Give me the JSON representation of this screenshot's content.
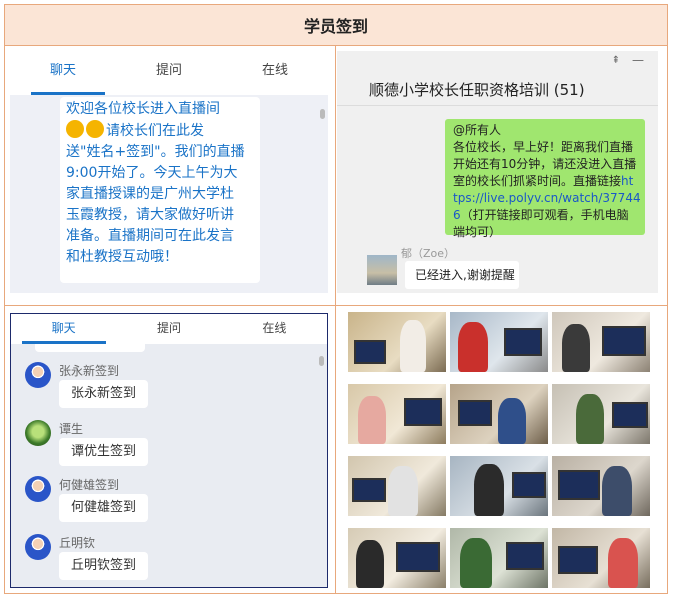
{
  "page": {
    "title": "学员签到"
  },
  "chat_panel_a": {
    "tabs": [
      {
        "label": "聊天",
        "active": true
      },
      {
        "label": "提问",
        "active": false
      },
      {
        "label": "在线",
        "active": false
      }
    ],
    "message_lines": [
      "欢迎各位校长进入直播间",
      "请校长们在此发",
      "送\"姓名+签到\"。我们的直播",
      "9:00开始了。今天上午为大",
      "家直播授课的是广州大学杜",
      "玉霞教授，请大家做好听讲",
      "准备。直播期间可在此发言",
      "和杜教授互动哦！"
    ],
    "accent_color": "#1a73c7"
  },
  "wechat_panel": {
    "group_title": "顺德小学校长任职资格培训 (51)",
    "pin_icon": "pin-icon",
    "minimize_icon": "minimize-icon",
    "message": {
      "lines_plain": [
        "@所有人",
        "各位校长，早上好！距离我们直播",
        "开始还有10分钟，请还没进入直播",
        "室的校长们抓紧时间。直播链接"
      ],
      "link_part1": "ht",
      "link_part2": "tps://live.polyv.cn/watch/37744",
      "link_part3": "6",
      "tail": "（打开链接即可观看，手机电脑",
      "tail2": "端均可）",
      "bubble_color": "#a0e66f"
    },
    "reply": {
      "sender": "郁（Zoe）",
      "text": "已经进入,谢谢提醒"
    }
  },
  "chat_panel_c": {
    "tabs": [
      {
        "label": "聊天",
        "active": true
      },
      {
        "label": "提问",
        "active": false
      },
      {
        "label": "在线",
        "active": false
      }
    ],
    "entries": [
      {
        "name": "张永新签到",
        "message": "张永新签到",
        "avatar": "user-avatar-blue"
      },
      {
        "name": "谭生",
        "message": "谭优生签到",
        "avatar": "user-avatar-green"
      },
      {
        "name": "何健雄签到",
        "message": "何健雄签到",
        "avatar": "user-avatar-blue"
      },
      {
        "name": "丘明钦",
        "message": "丘明钦签到",
        "avatar": "user-avatar-blue"
      }
    ]
  },
  "photo_grid": {
    "rows": 4,
    "cols": 3,
    "description_icon": "photo"
  },
  "colors": {
    "header_bg": "#fbe5d6",
    "border": "#e8a87c",
    "tab_active": "#1a73c7"
  }
}
